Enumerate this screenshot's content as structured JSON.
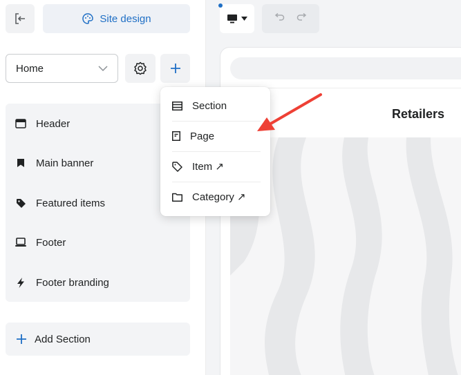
{
  "header": {
    "exit_icon": "exit-icon",
    "site_design_label": "Site design",
    "site_design_icon": "palette-icon"
  },
  "page_selector": {
    "selected": "Home",
    "icon": "chevron-down-icon"
  },
  "toolbar": {
    "settings_icon": "gear-icon",
    "add_icon": "plus-icon"
  },
  "sections": [
    {
      "label": "Header",
      "icon": "header-icon"
    },
    {
      "label": "Main banner",
      "icon": "bookmark-icon"
    },
    {
      "label": "Featured items",
      "icon": "tag-icon"
    },
    {
      "label": "Footer",
      "icon": "laptop-icon"
    },
    {
      "label": "Footer branding",
      "icon": "lightning-icon"
    }
  ],
  "add_section": {
    "label": "Add Section",
    "icon": "plus-icon"
  },
  "canvas": {
    "device_icon": "desktop-icon",
    "undo_icon": "undo-icon",
    "redo_icon": "redo-icon",
    "store_title": "Retailers"
  },
  "add_menu": {
    "items": [
      {
        "label": "Section",
        "icon": "section-icon"
      },
      {
        "label": "Page",
        "icon": "page-icon"
      },
      {
        "label": "Item ↗",
        "icon": "tag-icon"
      },
      {
        "label": "Category ↗",
        "icon": "folder-icon"
      }
    ]
  },
  "colors": {
    "accent": "#1f6fc5",
    "annotation_arrow": "#ee4035",
    "panel_bg": "#f3f4f6"
  }
}
